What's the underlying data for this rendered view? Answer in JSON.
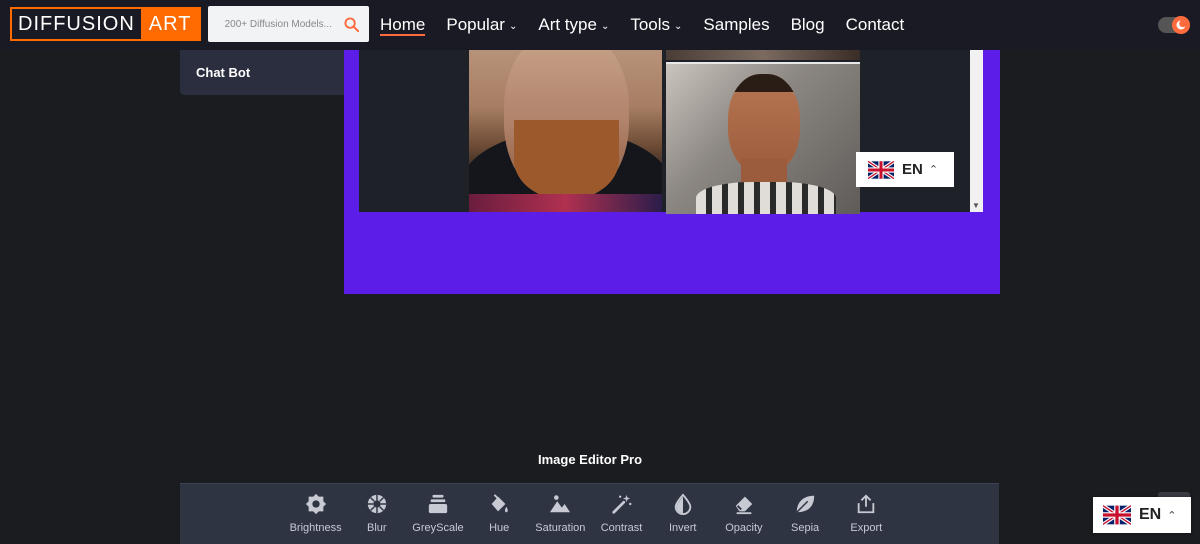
{
  "logo": {
    "part_a": "DIFFUSION",
    "part_b": "ART",
    "accent": "#ff6b00"
  },
  "search": {
    "placeholder": "200+ Diffusion Models..."
  },
  "nav": {
    "items": [
      {
        "label": "Home",
        "active": true,
        "dropdown": false
      },
      {
        "label": "Popular",
        "dropdown": true
      },
      {
        "label": "Art type",
        "dropdown": true
      },
      {
        "label": "Tools",
        "dropdown": true
      },
      {
        "label": "Samples",
        "dropdown": false
      },
      {
        "label": "Blog",
        "dropdown": false
      },
      {
        "label": "Contact",
        "dropdown": false
      }
    ]
  },
  "sidebar": {
    "items": [
      {
        "label": "Chat Bot"
      }
    ]
  },
  "language": {
    "code": "EN"
  },
  "editor": {
    "title": "Image Editor Pro",
    "tools": [
      {
        "label": "Brightness",
        "icon": "brightness-icon"
      },
      {
        "label": "Blur",
        "icon": "blur-icon"
      },
      {
        "label": "GreyScale",
        "icon": "greyscale-icon"
      },
      {
        "label": "Hue",
        "icon": "hue-icon"
      },
      {
        "label": "Saturation",
        "icon": "saturation-icon"
      },
      {
        "label": "Contrast",
        "icon": "contrast-icon"
      },
      {
        "label": "Invert",
        "icon": "invert-icon"
      },
      {
        "label": "Opacity",
        "icon": "opacity-icon"
      },
      {
        "label": "Sepia",
        "icon": "sepia-icon"
      },
      {
        "label": "Export",
        "icon": "export-icon"
      }
    ]
  },
  "colors": {
    "panel_purple": "#5d1de8",
    "nav_bg": "#1a1a24",
    "page_bg": "#1b1c1f",
    "toolbar_bg": "#2f3443"
  }
}
